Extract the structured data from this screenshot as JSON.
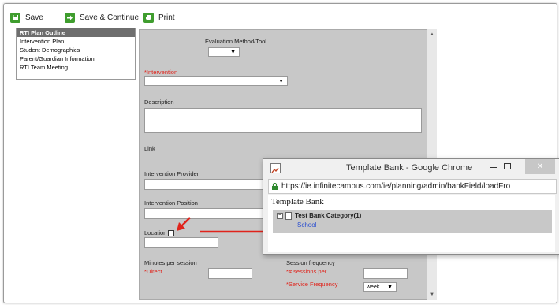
{
  "toolbar": {
    "save_label": "Save",
    "save_continue_label": "Save & Continue",
    "print_label": "Print"
  },
  "sidebar": {
    "items": [
      {
        "label": "RTI Plan Outline",
        "active": true
      },
      {
        "label": "Intervention Plan"
      },
      {
        "label": "Student Demographics"
      },
      {
        "label": "Parent/Guardian Information"
      },
      {
        "label": "RTI Team Meeting"
      }
    ]
  },
  "form": {
    "evaluation_method_label": "Evaluation Method/Tool",
    "intervention_label": "*Intervention",
    "description_label": "Description",
    "link_label": "Link",
    "intervention_provider_label": "Intervention Provider",
    "intervention_position_label": "Intervention Position",
    "location_label": "Location",
    "minutes_per_session_label": "Minutes per session",
    "direct_label": "*Direct",
    "session_frequency_label": "Session frequency",
    "sessions_per_label": "*# sessions per",
    "service_frequency_label": "*Service Frequency",
    "service_frequency_value": "week"
  },
  "popup": {
    "title": "Template Bank - Google Chrome",
    "url": "https://ie.infinitecampus.com/ie/planning/admin/bankField/loadFro",
    "heading": "Template Bank",
    "category": "Test Bank Category(1)",
    "item": "School"
  },
  "colors": {
    "toolbar_icon": "#3f9d2e",
    "required": "#e0231b",
    "annotation_arrow": "#e0231b",
    "link": "#2a4ed0",
    "form_background": "#c8c8c8"
  }
}
